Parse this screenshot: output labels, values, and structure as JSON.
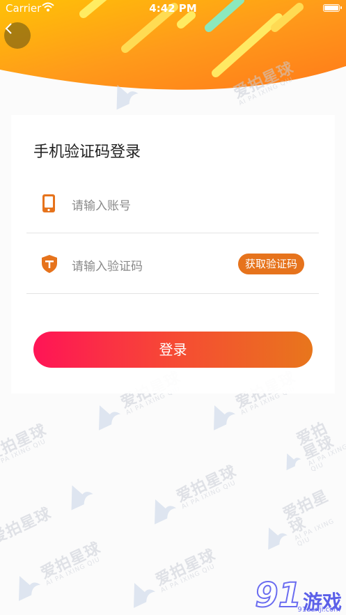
{
  "status_bar": {
    "carrier": "Carrier",
    "time": "4:42 PM"
  },
  "back_icon": "chevron-left-icon",
  "watermark": {
    "brand_cn": "爱拍星球",
    "brand_en": "AI PA IXING QIU"
  },
  "login": {
    "title": "手机验证码登录",
    "account_placeholder": "请输入账号",
    "code_placeholder": "请输入验证码",
    "get_code_label": "获取验证码",
    "submit_label": "登录"
  },
  "corner_logo": {
    "number": "91",
    "text": "游戏",
    "url": "91danji.com"
  },
  "colors": {
    "accent_orange": "#e6731c",
    "button_gradient_start": "#ff1456",
    "button_gradient_end": "#e8761c",
    "banner_yellow": "#ffc400"
  }
}
